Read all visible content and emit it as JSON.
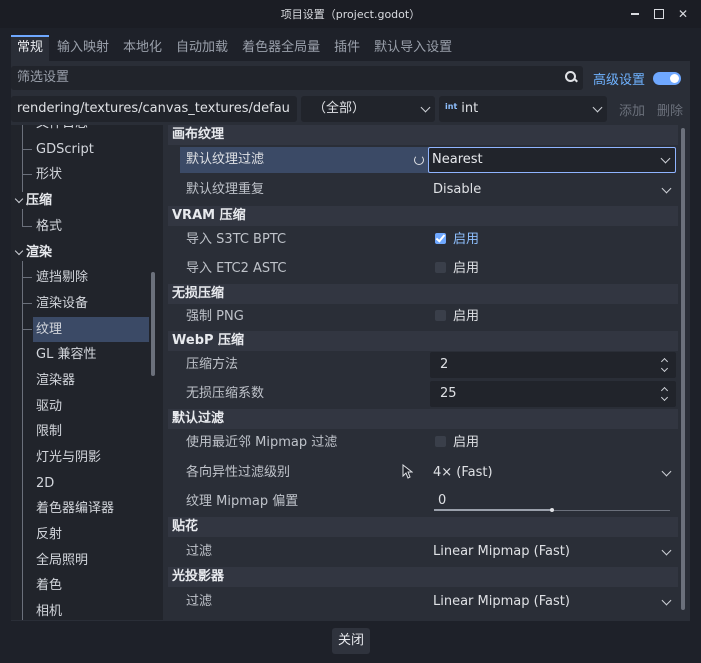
{
  "window": {
    "title": "项目设置（project.godot）"
  },
  "tabs": [
    {
      "label": "常规",
      "active": true
    },
    {
      "label": "输入映射"
    },
    {
      "label": "本地化"
    },
    {
      "label": "自动加载"
    },
    {
      "label": "着色器全局量"
    },
    {
      "label": "插件"
    },
    {
      "label": "默认导入设置"
    }
  ],
  "filter": {
    "placeholder": "筛选设置",
    "advanced_label": "高级设置"
  },
  "path_row": {
    "path": "rendering/textures/canvas_textures/defau",
    "feature_select": "（全部）",
    "type_select": "int",
    "type_icon": "int",
    "add_label": "添加",
    "delete_label": "删除"
  },
  "sidebar": {
    "items": [
      {
        "label": "文件日志",
        "level": 1,
        "partial": true
      },
      {
        "label": "GDScript",
        "level": 1
      },
      {
        "label": "形状",
        "level": 1
      },
      {
        "label": "压缩",
        "level": 0,
        "group": true
      },
      {
        "label": "格式",
        "level": 1
      },
      {
        "label": "渲染",
        "level": 0,
        "group": true
      },
      {
        "label": "遮挡剔除",
        "level": 1
      },
      {
        "label": "渲染设备",
        "level": 1
      },
      {
        "label": "纹理",
        "level": 1,
        "selected": true
      },
      {
        "label": "GL 兼容性",
        "level": 1
      },
      {
        "label": "渲染器",
        "level": 1
      },
      {
        "label": "驱动",
        "level": 1
      },
      {
        "label": "限制",
        "level": 1
      },
      {
        "label": "灯光与阴影",
        "level": 1
      },
      {
        "label": "2D",
        "level": 1
      },
      {
        "label": "着色器编译器",
        "level": 1
      },
      {
        "label": "反射",
        "level": 1
      },
      {
        "label": "全局照明",
        "level": 1
      },
      {
        "label": "着色",
        "level": 1
      },
      {
        "label": "相机",
        "level": 1
      }
    ]
  },
  "inspector": {
    "sections": [
      {
        "title": "画布纹理",
        "props": [
          {
            "label": "默认纹理过滤",
            "value": "Nearest",
            "kind": "dropdown-focused",
            "highlight": true
          },
          {
            "label": "默认纹理重复",
            "value": "Disable",
            "kind": "dropdown"
          }
        ]
      },
      {
        "title": "VRAM 压缩",
        "props": [
          {
            "label": "导入 S3TC BPTC",
            "value": "启用",
            "kind": "check",
            "checked": true
          },
          {
            "label": "导入 ETC2 ASTC",
            "value": "启用",
            "kind": "check",
            "checked": false
          }
        ]
      },
      {
        "title": "无损压缩",
        "props": [
          {
            "label": "强制 PNG",
            "value": "启用",
            "kind": "check",
            "checked": false
          }
        ]
      },
      {
        "title": "WebP 压缩",
        "props": [
          {
            "label": "压缩方法",
            "value": "2",
            "kind": "spin"
          },
          {
            "label": "无损压缩系数",
            "value": "25",
            "kind": "spin"
          }
        ]
      },
      {
        "title": "默认过滤",
        "props": [
          {
            "label": "使用最近邻 Mipmap 过滤",
            "value": "启用",
            "kind": "check",
            "checked": false
          },
          {
            "label": "各向异性过滤级别",
            "value": "4× (Fast)",
            "kind": "dropdown"
          },
          {
            "label": "纹理 Mipmap 偏置",
            "value": "0",
            "kind": "slider",
            "fraction": 0.5
          }
        ]
      },
      {
        "title": "贴花",
        "props": [
          {
            "label": "过滤",
            "value": "Linear Mipmap (Fast)",
            "kind": "dropdown"
          }
        ]
      },
      {
        "title": "光投影器",
        "props": [
          {
            "label": "过滤",
            "value": "Linear Mipmap (Fast)",
            "kind": "dropdown"
          }
        ]
      }
    ]
  },
  "footer": {
    "close_label": "关闭"
  }
}
